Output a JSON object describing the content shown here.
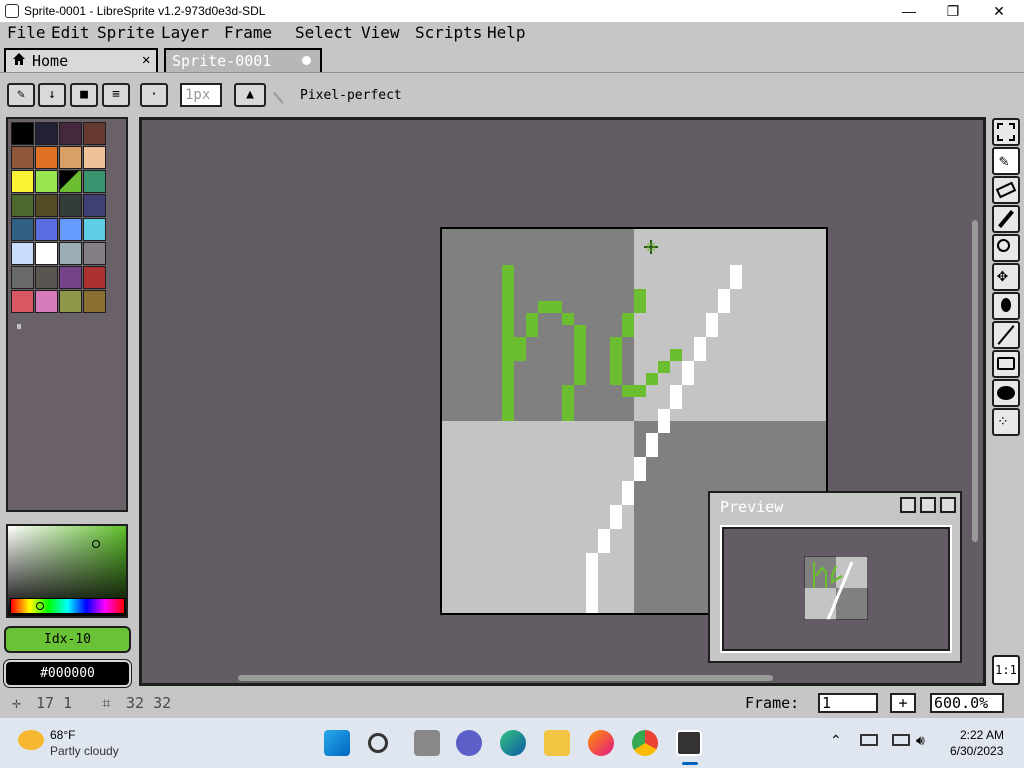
{
  "window": {
    "title": "Sprite-0001 - LibreSprite v1.2-973d0e3d-SDL",
    "minimize": "—",
    "maximize": "❐",
    "close": "✕"
  },
  "menu": [
    "File",
    "Edit",
    "Sprite",
    "Layer",
    "Frame",
    "Select",
    "View",
    "Scripts",
    "Help"
  ],
  "tabs": {
    "home": "Home",
    "home_close": "✕",
    "sprite": "Sprite-0001"
  },
  "toolbar": {
    "brush_size": "1px",
    "pixel_perfect": "Pixel-perfect"
  },
  "palette": {
    "colors": [
      "#000000",
      "#222034",
      "#45283c",
      "#663931",
      "#8f563b",
      "#df7126",
      "#d9a066",
      "#eec39a",
      "#fbf236",
      "#99e550",
      "#6abe30",
      "#37946e",
      "#4b692f",
      "#524b24",
      "#323c39",
      "#3f3f74",
      "#306082",
      "#5b6ee1",
      "#639bff",
      "#5fcde4",
      "#cbdbfc",
      "#ffffff",
      "#9badb7",
      "#847e87",
      "#696a6a",
      "#595652",
      "#76428a",
      "#ac3232",
      "#d95763",
      "#d77bba",
      "#8f974a",
      "#8a6f30"
    ],
    "selected_index": 10,
    "pause_icon": "⏸"
  },
  "colors": {
    "fg_label": "Idx-10",
    "bg_label": "#000000",
    "fg": "#6abe30",
    "bg": "#000000"
  },
  "preview": {
    "title": "Preview"
  },
  "status": {
    "cursor": "17 1",
    "size": "32 32",
    "frame_label": "Frame:",
    "frame_value": "1",
    "add": "+",
    "zoom": "600.0%"
  },
  "righttools": {
    "one_to_one": "1:1"
  },
  "taskbar": {
    "temp": "68°F",
    "weather": "Partly cloudy",
    "time": "2:22 AM",
    "date": "6/30/2023"
  }
}
